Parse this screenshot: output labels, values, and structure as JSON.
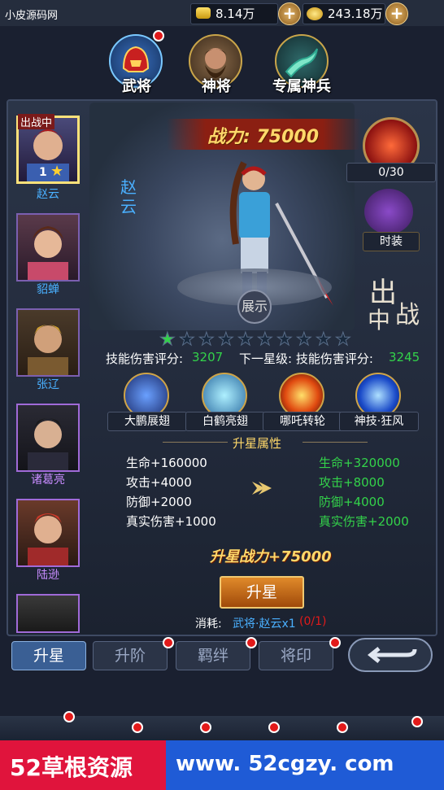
{
  "site_title": "小皮源码网",
  "resources": {
    "gold": "8.14万",
    "coins": "243.18万"
  },
  "top_tabs": [
    {
      "label": "武将"
    },
    {
      "label": "神将"
    },
    {
      "label": "专属神兵"
    }
  ],
  "heroes": [
    {
      "name": "赵云",
      "badge": "出战中",
      "level": "1"
    },
    {
      "name": "貂蝉"
    },
    {
      "name": "张辽"
    },
    {
      "name": "诸葛亮"
    },
    {
      "name": "陆逊"
    }
  ],
  "hero_detail": {
    "name": "赵云",
    "power_label": "战力: 75000",
    "exhibit": "展示",
    "deploy_line1": "出",
    "deploy_line2": "中",
    "deploy_line3": "战",
    "item_count": "0/30",
    "fashion": "时装"
  },
  "stars": {
    "filled": 1,
    "total": 10
  },
  "skill_score": {
    "label": "技能伤害评分:",
    "value": "3207",
    "next_label": "下一星级: 技能伤害评分:",
    "next_value": "3245"
  },
  "skills": [
    "大鹏展翅",
    "白鹤亮翅",
    "哪吒转轮",
    "神技·狂风"
  ],
  "upgrade": {
    "title": "升星属性",
    "current": [
      "生命+160000",
      "攻击+4000",
      "防御+2000",
      "真实伤害+1000"
    ],
    "next": [
      "生命+320000",
      "攻击+8000",
      "防御+4000",
      "真实伤害+2000"
    ],
    "power_gain": "升星战力+75000",
    "button": "升星",
    "cost_label": "消耗:",
    "cost_item": "武将·赵云x1",
    "cost_count": "(0/1)"
  },
  "bottom_tabs": [
    "升星",
    "升阶",
    "羁绊",
    "将印"
  ],
  "banner": {
    "left": "52草根资源",
    "right": "www. 52cgzy. com"
  },
  "colors": {
    "green": "#33d24a",
    "red": "#e21a1a",
    "gold": "#ffd86a",
    "blue_link": "#4ab0ff"
  }
}
